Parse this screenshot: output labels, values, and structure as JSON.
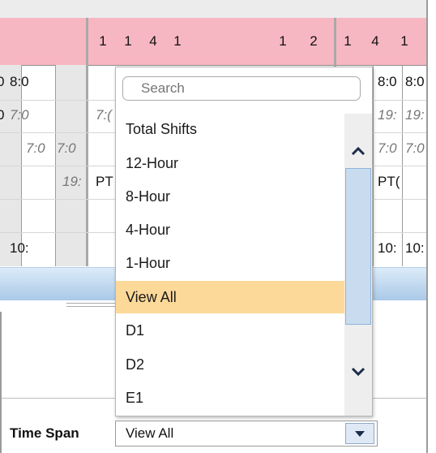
{
  "header": {
    "day_numbers": [
      "1",
      "1",
      "4",
      "1",
      "1",
      "2",
      "1",
      "4",
      "1"
    ]
  },
  "grid": {
    "left_cells": [
      {
        "text": "8:0",
        "italic": false
      },
      {
        "text": "7:0",
        "italic": true
      },
      {
        "text": "7:0",
        "italic": true
      },
      {
        "text": "7:0",
        "italic": true
      },
      {
        "text": "19:",
        "italic": true
      },
      {
        "text": "10:",
        "italic": false
      }
    ],
    "left_edge_glyphs": [
      "0",
      "0",
      ":"
    ],
    "middle_cells": [
      "7:(",
      "PT"
    ],
    "right_cells": [
      {
        "text": "8:0",
        "italic": false
      },
      {
        "text": "8:0",
        "italic": false
      },
      {
        "text": "19:",
        "italic": true
      },
      {
        "text": "19:",
        "italic": true
      },
      {
        "text": "7:0",
        "italic": true
      },
      {
        "text": "7:0",
        "italic": true
      },
      {
        "text": "PT(",
        "italic": false
      },
      {
        "text": "10:",
        "italic": false
      },
      {
        "text": "10:",
        "italic": false
      }
    ]
  },
  "dropdown": {
    "search_placeholder": "Search",
    "options": [
      "Total Shifts",
      "12-Hour",
      "8-Hour",
      "4-Hour",
      "1-Hour",
      "View All",
      "D1",
      "D2",
      "E1"
    ],
    "selected_index": 5,
    "scroll_up_icon": "chevron-up-icon",
    "scroll_down_icon": "chevron-down-icon"
  },
  "footer": {
    "time_span_label": "Time Span",
    "time_span_value": "View All",
    "dropdown_icon": "caret-down-icon"
  },
  "colors": {
    "header_pink": "#f7b7c2",
    "selected_option": "#fdd999",
    "accent_blue": "#a9c9e8",
    "scroll_thumb": "#c9dcef"
  }
}
